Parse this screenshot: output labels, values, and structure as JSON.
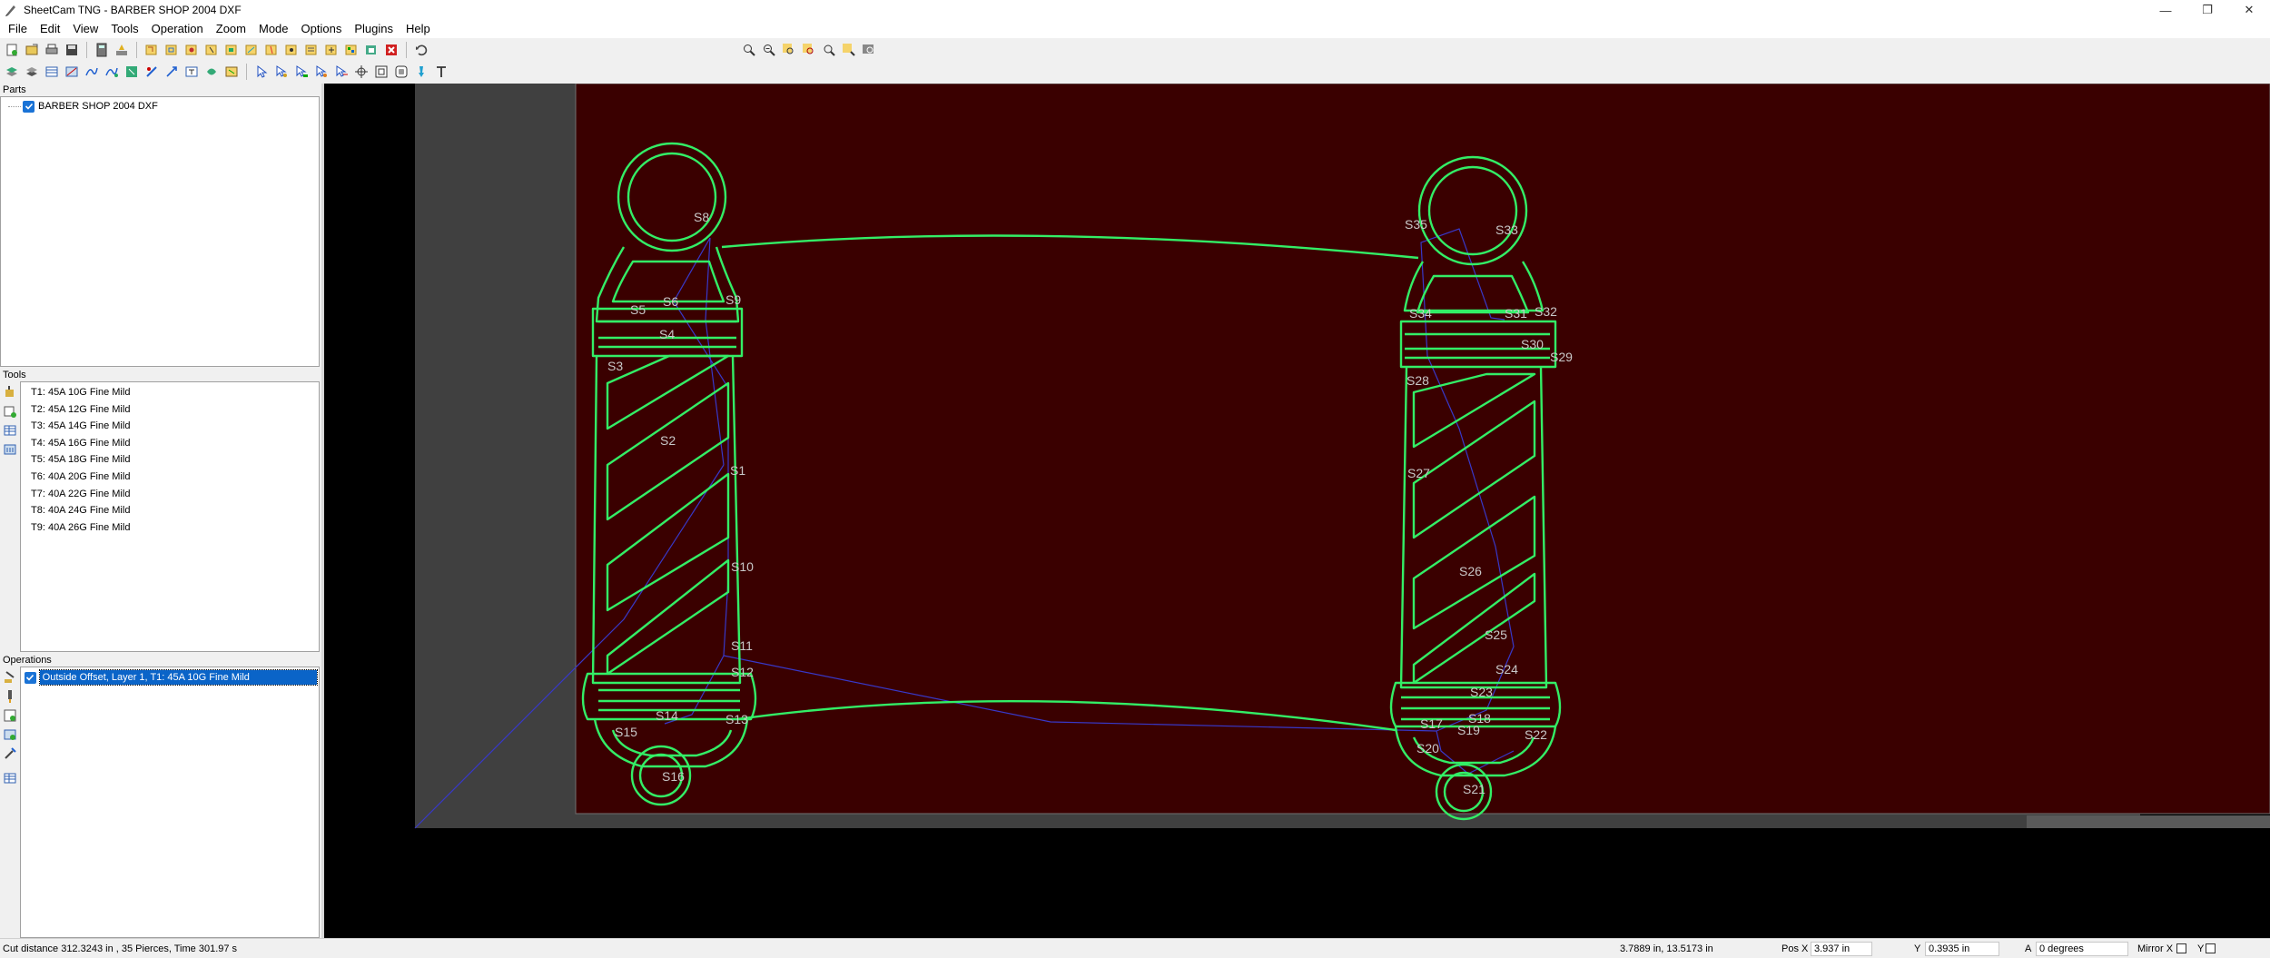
{
  "window": {
    "title": "SheetCam TNG - BARBER SHOP 2004 DXF",
    "controls": {
      "minimize": "—",
      "maximize": "❐",
      "close": "✕"
    }
  },
  "menu": [
    "File",
    "Edit",
    "View",
    "Tools",
    "Operation",
    "Zoom",
    "Mode",
    "Options",
    "Plugins",
    "Help"
  ],
  "panels": {
    "parts": {
      "header": "Parts",
      "items": [
        {
          "label": "BARBER SHOP 2004 DXF",
          "checked": true
        }
      ]
    },
    "tools": {
      "header": "Tools",
      "items": [
        "T1: 45A 10G Fine Mild",
        "T2: 45A 12G Fine Mild",
        "T3: 45A 14G Fine Mild",
        "T4: 45A 16G Fine Mild",
        "T5: 45A 18G Fine Mild",
        "T6: 40A 20G Fine Mild",
        "T7: 40A 22G Fine Mild",
        "T8: 40A 24G Fine Mild",
        "T9: 40A 26G Fine Mild"
      ]
    },
    "operations": {
      "header": "Operations",
      "items": [
        {
          "label": "Outside Offset, Layer 1, T1: 45A 10G Fine Mild",
          "checked": true,
          "selected": true
        }
      ]
    }
  },
  "canvas": {
    "colors": {
      "background": "#000000",
      "sheet": "#3a0000",
      "table": "#404040",
      "contour": "#33ee66",
      "rapid": "#3838c8",
      "label": "#c8c8c8"
    },
    "left_labels": [
      "S8",
      "S6",
      "S9",
      "S5",
      "S4",
      "S3",
      "S2",
      "S1",
      "S10",
      "S11",
      "S12",
      "S13",
      "S14",
      "S15",
      "S16"
    ],
    "right_labels": [
      "S35",
      "S33",
      "S34",
      "S31",
      "S32",
      "S30",
      "S29",
      "S28",
      "S27",
      "S26",
      "S25",
      "S24",
      "S23",
      "S22",
      "S18",
      "S19",
      "S20",
      "S21",
      "S17"
    ]
  },
  "status": {
    "summary": "Cut distance 312.3243 in , 35 Pierces, Time 301.97 s",
    "coords": "3.7889 in, 13.5173 in",
    "posx_label": "Pos X",
    "posx_value": "3.937 in",
    "y_label": "Y",
    "y_value": "0.3935 in",
    "a_label": "A",
    "a_value": "0 degrees",
    "mirrorx_label": "Mirror X",
    "mirrory_label": "Y"
  }
}
